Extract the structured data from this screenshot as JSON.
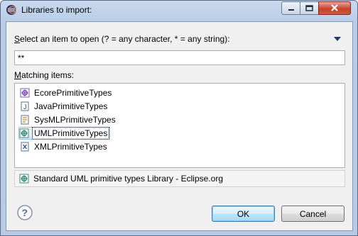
{
  "window": {
    "title": "Libraries to import:",
    "controls": {
      "minimize": "minimize",
      "maximize": "maximize",
      "close": "close"
    }
  },
  "dialog": {
    "prompt_mnemonic": "S",
    "prompt_rest": "elect an item to open (? = any character, * = any string):",
    "pattern_value": "**",
    "matching_mnemonic": "M",
    "matching_rest": "atching items:",
    "items": [
      {
        "label": "EcorePrimitiveTypes",
        "icon": "ecore-library-icon",
        "selected": false
      },
      {
        "label": "JavaPrimitiveTypes",
        "icon": "java-library-icon",
        "selected": false
      },
      {
        "label": "SysMLPrimitiveTypes",
        "icon": "sysml-library-icon",
        "selected": false
      },
      {
        "label": "UMLPrimitiveTypes",
        "icon": "uml-library-icon",
        "selected": true
      },
      {
        "label": "XMLPrimitiveTypes",
        "icon": "xml-library-icon",
        "selected": false
      }
    ],
    "status_text": "Standard UML primitive types Library - Eclipse.org",
    "buttons": {
      "ok": "OK",
      "cancel": "Cancel"
    }
  },
  "colors": {
    "title_bar": "#c9d9ee",
    "close_button": "#c7432c",
    "selection": "#dbeaf9",
    "dialog_background": "#f0f0f0"
  }
}
